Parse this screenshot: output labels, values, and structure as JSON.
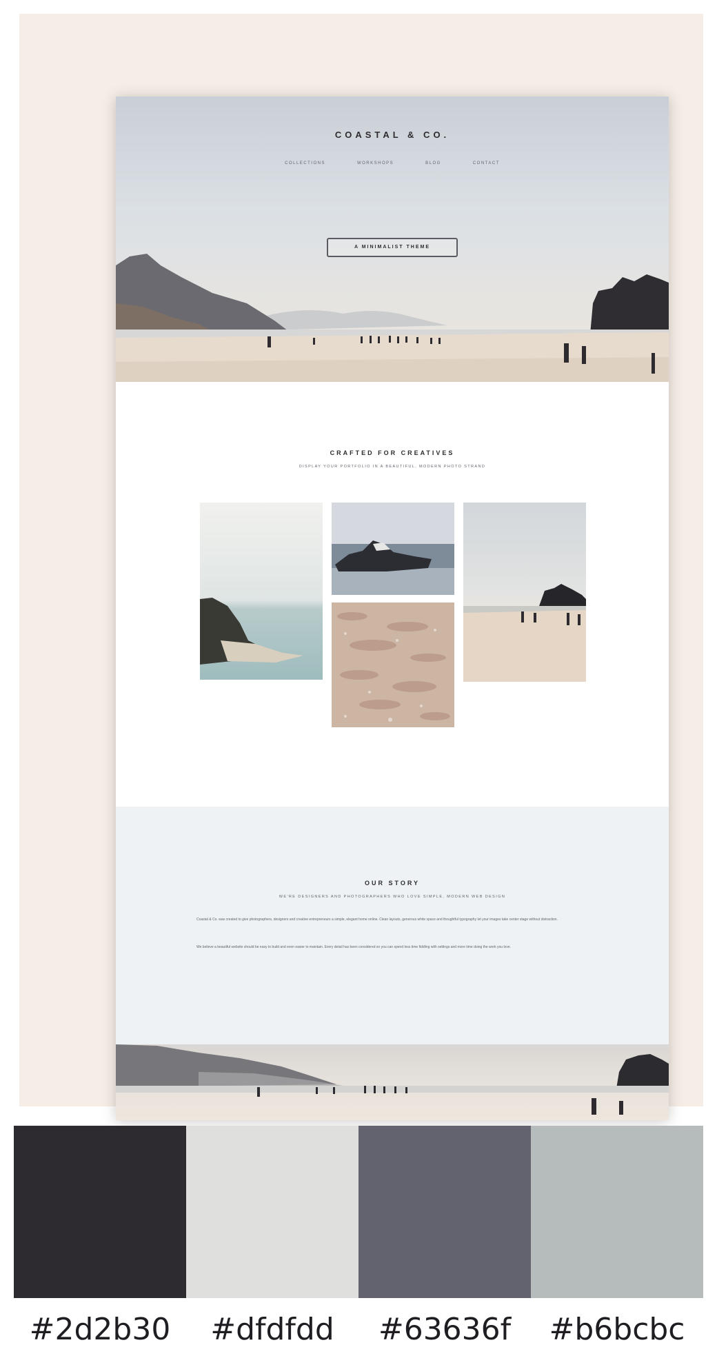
{
  "site": {
    "title": "COASTAL & CO.",
    "nav": [
      "COLLECTIONS",
      "WORKSHOPS",
      "BLOG",
      "CONTACT"
    ],
    "hero_button": "A MINIMALIST THEME",
    "creatives_title": "CRAFTED FOR CREATIVES",
    "creatives_subtitle": "DISPLAY YOUR PORTFOLIO IN A BEAUTIFUL, MODERN PHOTO STRAND",
    "story_title": "OUR STORY",
    "story_subtitle": "WE'RE DESIGNERS AND PHOTOGRAPHERS WHO LOVE SIMPLE, MODERN WEB DESIGN",
    "story_paragraphs": [
      "Coastal & Co. was created to give photographers, designers and creative entrepreneurs a simple, elegant home online. Clean layouts, generous white space and thoughtful typography let your images take center stage without distraction.",
      "We believe a beautiful website should be easy to build and even easier to maintain. Every detail has been considered so you can spend less time fiddling with settings and more time doing the work you love."
    ]
  },
  "palette": [
    {
      "hex": "#2d2b30",
      "label": "#2d2b30"
    },
    {
      "hex": "#dfdfdd",
      "label": "#dfdfdd"
    },
    {
      "hex": "#63636f",
      "label": "#63636f"
    },
    {
      "hex": "#b6bcbc",
      "label": "#b6bcbc"
    }
  ]
}
